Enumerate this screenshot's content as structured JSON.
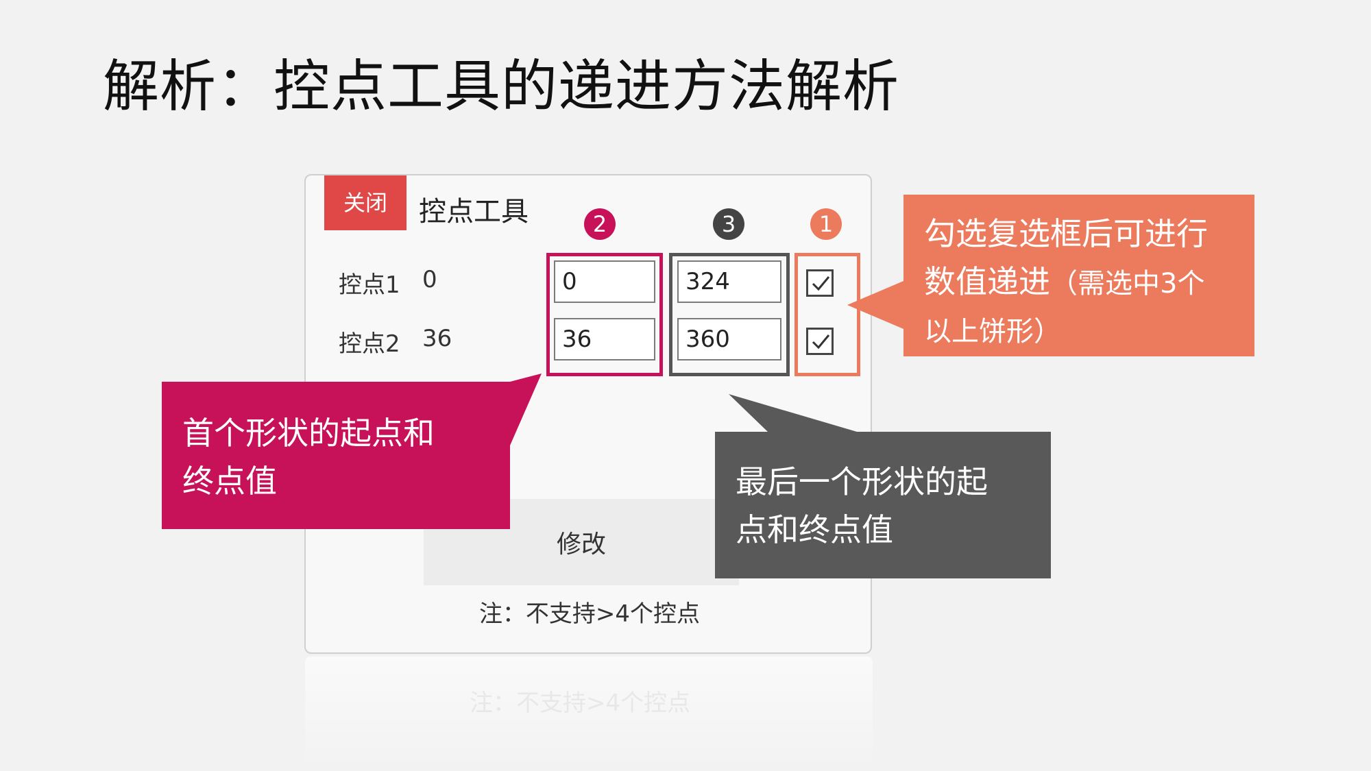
{
  "slide": {
    "title": "解析：控点工具的递进方法解析"
  },
  "panel": {
    "close_label": "关闭",
    "title": "控点工具",
    "rows": [
      {
        "label": "控点1",
        "value": "0",
        "start_field": "0",
        "end_field": "324",
        "checked": true
      },
      {
        "label": "控点2",
        "value": "36",
        "start_field": "36",
        "end_field": "360",
        "checked": true
      }
    ],
    "modify_label": "修改",
    "note": "注：不支持>4个控点",
    "reflection_text": "注：不支持>4个控点"
  },
  "badges": {
    "one": "1",
    "two": "2",
    "three": "3"
  },
  "callouts": {
    "first_shape_line1": "首个形状的起点和",
    "first_shape_line2": "终点值",
    "last_shape_line1": "最后一个形状的起",
    "last_shape_line2": "点和终点值",
    "checkbox_line1": "勾选复选框后可进行",
    "checkbox_line2_main": "数值递进",
    "checkbox_line2_small": "（需选中3个",
    "checkbox_line3": "以上饼形）"
  },
  "colors": {
    "magenta": "#c71158",
    "dark": "#595959",
    "orange": "#ec7a5d",
    "close_red": "#e04848",
    "background": "#f2f2f2"
  },
  "icons": {
    "check": "check-icon"
  }
}
